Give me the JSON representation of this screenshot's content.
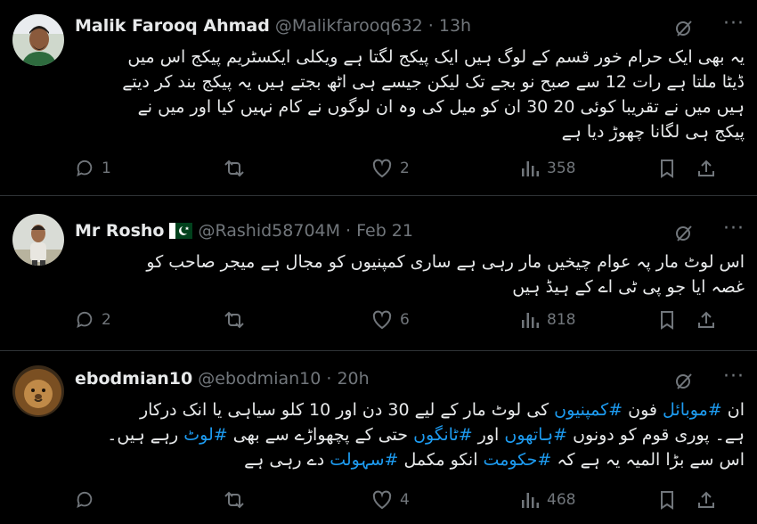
{
  "tweets": [
    {
      "name": "Malik Farooq Ahmad",
      "handle": "@Malikfarooq632 · 13h",
      "lines": [
        "یہ بھی ایک حرام خور قسم کے لوگ ہیں ایک پیکج لگتا ہے ویکلی ایکسٹریم پیکج اس میں",
        "ڈیٹا ملتا ہے رات 12 سے صبح نو بجے تک لیکن جیسے ہی اٹھ بجتے ہیں یہ پیکج بند کر دیتے",
        "ہیں میں نے تقریبا کوئی 20 30 ان کو میل کی وہ ان لوگوں نے کام نہیں کیا اور میں نے",
        "پیکج ہی لگانا چھوڑ دیا ہے"
      ],
      "replies": "1",
      "reposts": "",
      "likes": "2",
      "views": "358"
    },
    {
      "name": "Mr Rosho",
      "flag": "pakistan-flag",
      "handle": "@Rashid58704M · Feb 21",
      "lines": [
        "اس لوٹ مار پہ عوام چیخیں مار رہی ہے ساری کمپنیوں کو مجال ہے میجر صاحب کو",
        "غصہ ایا جو پی ٹی اے کے ہیڈ ہیں"
      ],
      "replies": "2",
      "reposts": "",
      "likes": "6",
      "views": "818"
    },
    {
      "name": "ebodmian10",
      "handle": "@ebodmian10 · 20h",
      "line1": {
        "a": "ان",
        "tag1": "#موبائل",
        "b": "فون",
        "tag2": "#کمپنیوں",
        "c": "کی لوٹ مار کے لیے 30 دن اور 10 کلو سیاہی یا انک درکار"
      },
      "line2": {
        "a": "ہے۔ پوری قوم کو دونوں",
        "tag1": "#ہاتھوں",
        "b": "اور",
        "tag2": "#ٹانگوں",
        "c": "حتی کے پچھواڑے سے بھی",
        "tag3": "#لوٹ",
        "d": "رہے ہیں۔"
      },
      "line3": {
        "a": "اس سے بڑا المیہ یہ ہے کہ",
        "tag1": "#حکومت",
        "b": "انکو مکمل",
        "tag2": "#سہولت",
        "c": "دے رہی ہے"
      },
      "replies": "",
      "reposts": "",
      "likes": "4",
      "views": "468"
    }
  ],
  "colors": {
    "background": "#000000",
    "text": "#e7e9ea",
    "muted": "#71767b",
    "link": "#1d9bf0",
    "divider": "#2f3336"
  }
}
